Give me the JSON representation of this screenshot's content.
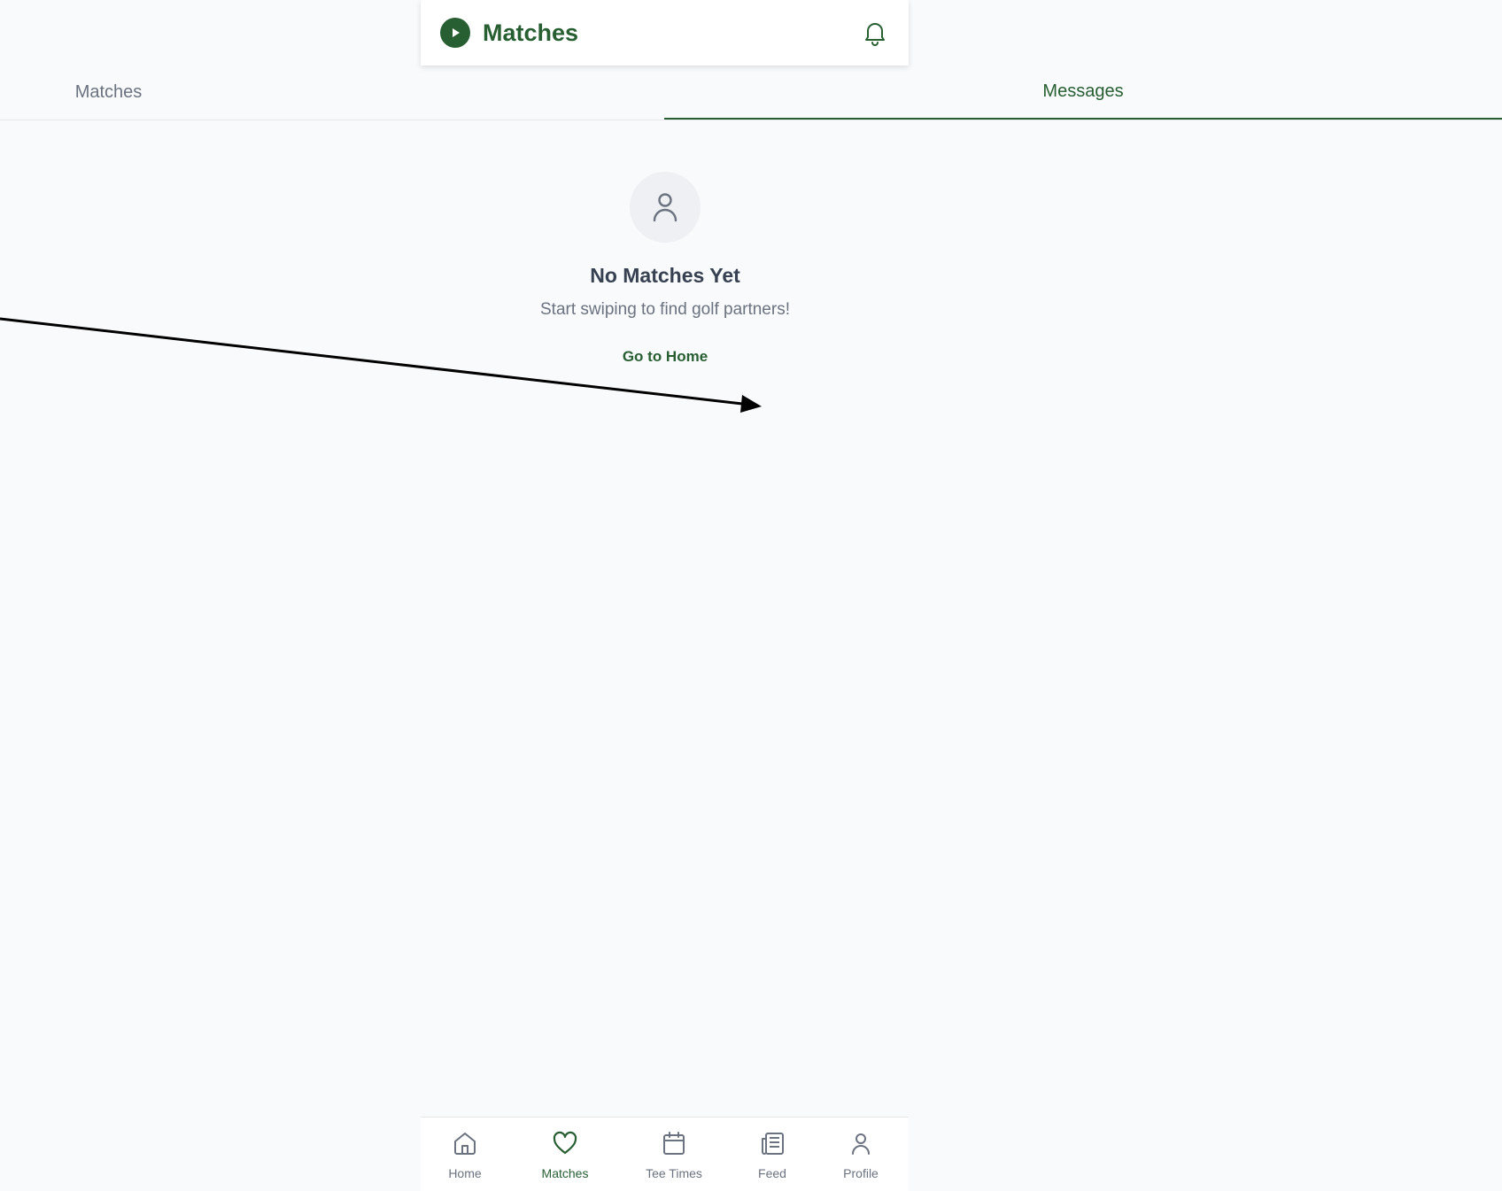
{
  "header": {
    "title": "Matches",
    "logo_icon": "play-circle-icon",
    "notification_icon": "bell-icon"
  },
  "tabs": [
    {
      "label": "Matches",
      "active": false
    },
    {
      "label": "Messages",
      "active": true
    }
  ],
  "empty_state": {
    "icon": "user-icon",
    "headline": "No Matches Yet",
    "subtext": "Start swiping to find golf partners!",
    "action_label": "Go to Home"
  },
  "bottom_nav": {
    "items": [
      {
        "label": "Home",
        "icon": "home-icon",
        "active": false
      },
      {
        "label": "Matches",
        "icon": "heart-icon",
        "active": true
      },
      {
        "label": "Tee Times",
        "icon": "calendar-icon",
        "active": false
      },
      {
        "label": "Feed",
        "icon": "newspaper-icon",
        "active": false
      },
      {
        "label": "Profile",
        "icon": "user-icon",
        "active": false
      }
    ]
  },
  "colors": {
    "accent": "#275e32",
    "background": "#f8fafc",
    "muted_text": "#6b7280",
    "heading_text": "#374151"
  }
}
